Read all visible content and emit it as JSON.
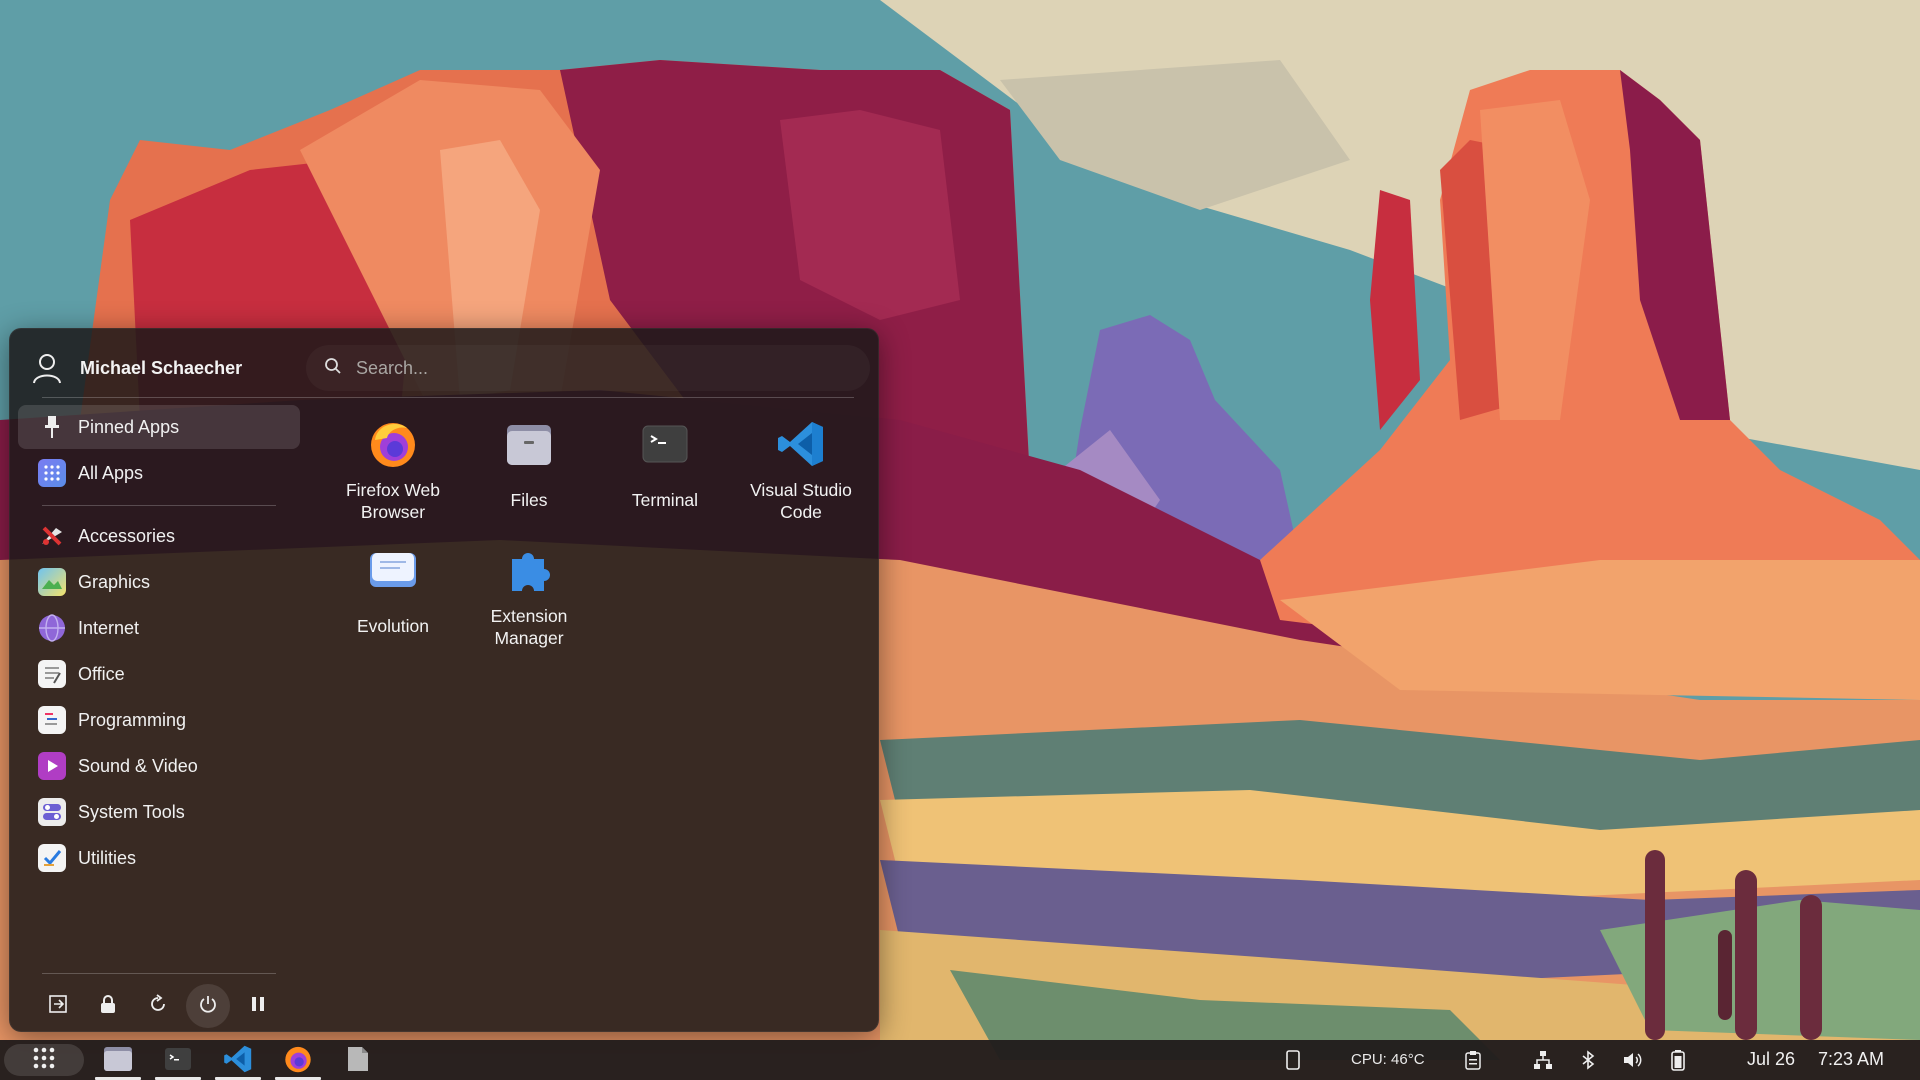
{
  "user": {
    "name": "Michael Schaecher"
  },
  "search": {
    "placeholder": "Search..."
  },
  "nav": {
    "pinned": {
      "label": "Pinned Apps",
      "icon": "pin-icon"
    },
    "all": {
      "label": "All Apps",
      "icon": "grid-icon"
    },
    "categories": [
      {
        "label": "Accessories",
        "icon": "accessories-icon"
      },
      {
        "label": "Graphics",
        "icon": "graphics-icon"
      },
      {
        "label": "Internet",
        "icon": "internet-icon"
      },
      {
        "label": "Office",
        "icon": "office-icon"
      },
      {
        "label": "Programming",
        "icon": "programming-icon"
      },
      {
        "label": "Sound & Video",
        "icon": "sound-video-icon"
      },
      {
        "label": "System Tools",
        "icon": "system-tools-icon"
      },
      {
        "label": "Utilities",
        "icon": "utilities-icon"
      }
    ]
  },
  "apps": [
    {
      "label": "Firefox Web Browser",
      "icon": "firefox-icon"
    },
    {
      "label": "Files",
      "icon": "files-icon"
    },
    {
      "label": "Terminal",
      "icon": "terminal-icon"
    },
    {
      "label": "Visual Studio Code",
      "icon": "vscode-icon"
    },
    {
      "label": "Evolution",
      "icon": "evolution-icon"
    },
    {
      "label": "Extension Manager",
      "icon": "extension-manager-icon"
    }
  ],
  "power": [
    "logout-icon",
    "lock-icon",
    "restart-icon",
    "power-icon",
    "suspend-icon"
  ],
  "taskbar": {
    "apps": [
      "files-icon",
      "terminal-icon",
      "vscode-icon",
      "firefox-icon",
      "text-editor-icon"
    ],
    "cpu": "CPU: 46°C",
    "date": "Jul 26",
    "time": "7:23 AM"
  },
  "colors": {
    "menu_bg": "#1c1818",
    "highlight": "#3a3535",
    "vscode_blue": "#2c8fdc",
    "firefox_orange": "#ff8a1c"
  }
}
